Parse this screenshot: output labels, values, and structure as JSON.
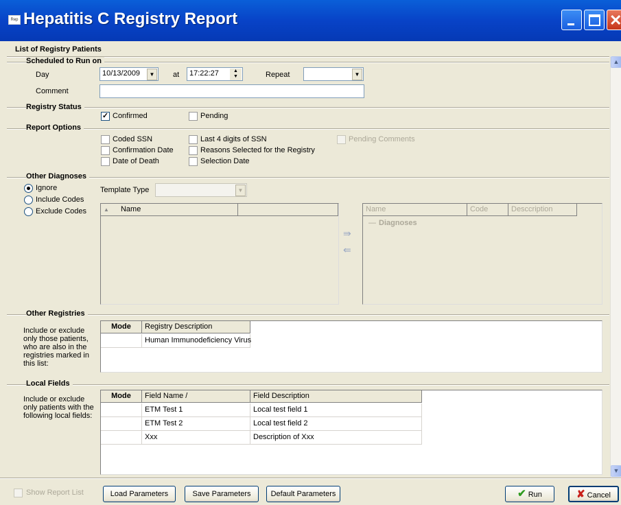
{
  "window": {
    "title": "Hepatitis C Registry Report",
    "icon_text": "Rep"
  },
  "page_heading": "List of Registry Patients",
  "schedule": {
    "section_label": "Scheduled to Run on",
    "day_label": "Day",
    "day_value": "10/13/2009",
    "at_label": "at",
    "time_value": "17:22:27",
    "repeat_label": "Repeat",
    "repeat_value": "",
    "comment_label": "Comment",
    "comment_value": ""
  },
  "registry_status": {
    "section_label": "Registry Status",
    "confirmed_label": "Confirmed",
    "confirmed_checked": true,
    "pending_label": "Pending",
    "pending_checked": false
  },
  "report_options": {
    "section_label": "Report Options",
    "coded_ssn": "Coded SSN",
    "confirmation_date": "Confirmation Date",
    "date_of_death": "Date of Death",
    "last4_ssn": "Last 4 digits of SSN",
    "reasons_selected": "Reasons Selected for the Registry",
    "selection_date": "Selection Date",
    "pending_comments": "Pending Comments"
  },
  "other_diagnoses": {
    "section_label": "Other Diagnoses",
    "ignore_label": "Ignore",
    "include_label": "Include Codes",
    "exclude_label": "Exclude Codes",
    "selected": "Ignore",
    "template_type_label": "Template Type",
    "template_type_value": "",
    "left_columns": [
      "Name"
    ],
    "right_columns": [
      "Name",
      "Code",
      "Desccription"
    ],
    "right_group": "Diagnoses",
    "add_icon": "double-right-arrow",
    "remove_icon": "double-left-arrow"
  },
  "other_registries": {
    "section_label": "Other Registries",
    "description": "Include or exclude only those patients, who are also in the registries marked in this list:",
    "columns": [
      "Mode",
      "Registry Description"
    ],
    "rows": [
      {
        "mode": "",
        "description": "Human Immunodeficiency Virus"
      }
    ]
  },
  "local_fields": {
    "section_label": "Local Fields",
    "description": "Include or exclude only patients with the following local fields:",
    "columns": [
      "Mode",
      "Field Name /",
      "Field Description"
    ],
    "rows": [
      {
        "mode": "",
        "name": "ETM Test 1",
        "description": "Local test field 1"
      },
      {
        "mode": "",
        "name": "ETM Test 2",
        "description": "Local test field 2"
      },
      {
        "mode": "",
        "name": "Xxx",
        "description": "Description of Xxx"
      }
    ]
  },
  "footer": {
    "show_report_list": "Show Report List",
    "load_parameters": "Load Parameters",
    "save_parameters": "Save Parameters",
    "default_parameters": "Default Parameters",
    "run": "Run",
    "cancel": "Cancel"
  },
  "colors": {
    "titlebar": "#0a5fd8",
    "window_bg": "#ece9d8",
    "run_icon": "#2e9a1f",
    "cancel_icon": "#c8201a"
  }
}
